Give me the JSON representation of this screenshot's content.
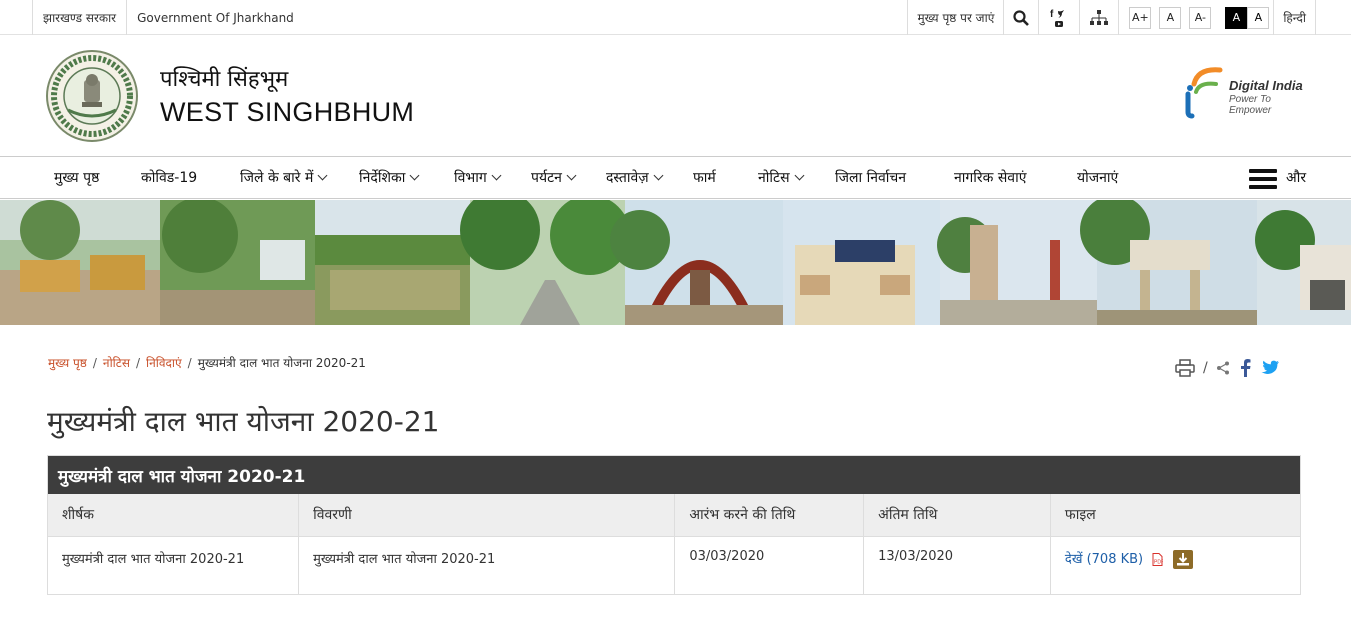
{
  "topbar": {
    "state_label": "झारखण्ड सरकार",
    "govt_label": "Government Of Jharkhand",
    "home_link": "मुख्य पृष्ठ पर जाएं",
    "font_increase": "A+",
    "font_normal": "A",
    "font_decrease": "A-",
    "contrast_dark": "A",
    "contrast_light": "A",
    "language": "हिन्दी"
  },
  "header": {
    "title_hi": "पश्चिमी सिंहभूम",
    "title_en": "WEST SINGHBHUM",
    "di_title": "Digital India",
    "di_tagline": "Power To Empower"
  },
  "nav": {
    "items": [
      "मुख्य पृष्ठ",
      "कोविड-19",
      "जिले के बारे में",
      "निर्देशिका",
      "विभाग",
      "पर्यटन",
      "दस्तावेज़",
      "फार्म",
      "नोटिस",
      "जिला निर्वाचन",
      "नागरिक सेवाएं",
      "योजनाएं"
    ],
    "more": "और"
  },
  "breadcrumb": {
    "home": "मुख्य पृष्ठ",
    "notice": "नोटिस",
    "tenders": "निविदाएं",
    "current": "मुख्यमंत्री दाल भात योजना 2020-21"
  },
  "page": {
    "title": "मुख्यमंत्री दाल भात योजना 2020-21"
  },
  "table": {
    "caption": "मुख्यमंत्री दाल भात योजना 2020-21",
    "headers": [
      "शीर्षक",
      "विवरणी",
      "आरंभ करने की तिथि",
      "अंतिम तिथि",
      "फाइल"
    ],
    "rows": [
      {
        "title": "मुख्यमंत्री दाल भात योजना 2020-21",
        "description": "मुख्यमंत्री दाल भात योजना 2020-21",
        "start_date": "03/03/2020",
        "end_date": "13/03/2020",
        "file_label": "देखें (708 KB)"
      }
    ]
  },
  "colors": {
    "breadcrumb_link": "#c8502a",
    "table_caption_bg": "#3d3d3d",
    "file_link": "#1e5fa8",
    "download_button": "#8d6b28"
  }
}
